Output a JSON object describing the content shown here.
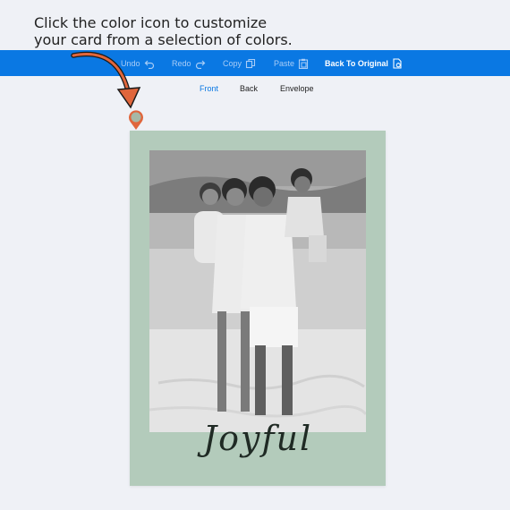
{
  "instruction": {
    "line1": "Click the color icon to customize",
    "line2": "your card from a selection of colors."
  },
  "toolbar": {
    "undo_label": "Undo",
    "redo_label": "Redo",
    "copy_label": "Copy",
    "paste_label": "Paste",
    "back_to_original_label": "Back To Original"
  },
  "tabs": [
    {
      "label": "Front",
      "active": true
    },
    {
      "label": "Back",
      "active": false
    },
    {
      "label": "Envelope",
      "active": false
    }
  ],
  "card": {
    "greeting": "Joyful",
    "background_color": "#b3cbbb",
    "photo_description_icon": "family-photo"
  },
  "colors": {
    "toolbar": "#0a78e3",
    "active_tab": "#0a78e3",
    "pin": "#e0663c",
    "arrow": "#e0663c"
  }
}
